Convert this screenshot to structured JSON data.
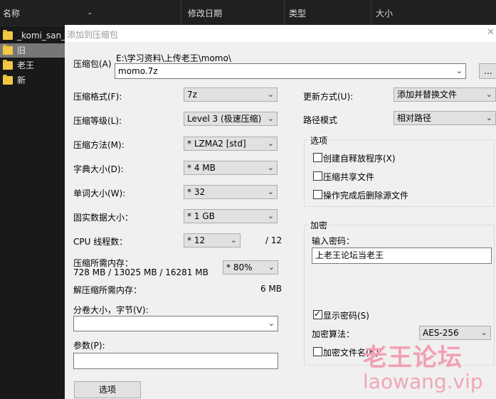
{
  "explorer": {
    "columns": [
      "名称",
      "修改日期",
      "类型",
      "大小"
    ],
    "files": [
      {
        "name": "_komi_san_",
        "selected": false
      },
      {
        "name": "旧",
        "selected": true
      },
      {
        "name": "老王",
        "selected": false
      },
      {
        "name": "新",
        "selected": false
      }
    ]
  },
  "dialog": {
    "title": "添加到压缩包",
    "archive_label": "压缩包(A)",
    "archive_path": "E:\\学习资料\\上传老王\\momo\\",
    "archive_name": "momo.7z",
    "browse_label": "...",
    "format_label": "压缩格式(F):",
    "format_value": "7z",
    "level_label": "压缩等级(L):",
    "level_value": "Level 3 (极速压缩)",
    "method_label": "压缩方法(M):",
    "method_value": "*  LZMA2 [std]",
    "dict_label": "字典大小(D):",
    "dict_value": "*  4 MB",
    "word_label": "单词大小(W):",
    "word_value": "*  32",
    "solid_label": "固实数据大小：",
    "solid_value": "*  1 GB",
    "cpu_label": "CPU 线程数：",
    "cpu_value": "*  12",
    "cpu_total": "/ 12",
    "mem_label": "压缩所需内存：",
    "mem_detail": "728 MB / 13025 MB / 16281 MB",
    "mem_value": "* 80%",
    "decomp_label": "解压缩所需内存：",
    "decomp_value": "6 MB",
    "split_label": "分卷大小，字节(V):",
    "split_value": "",
    "params_label": "参数(P):",
    "params_value": "",
    "options_button": "选项",
    "update_label": "更新方式(U):",
    "update_value": "添加并替换文件",
    "path_label": "路径模式",
    "path_value": "相对路径",
    "options_group": {
      "title": "选项",
      "items": [
        {
          "label": "创建自释放程序(X)",
          "checked": false
        },
        {
          "label": "压缩共享文件",
          "checked": false
        },
        {
          "label": "操作完成后删除源文件",
          "checked": false
        }
      ]
    },
    "encrypt_group": {
      "title": "加密",
      "password_label": "输入密码：",
      "password_value": "上老王论坛当老王",
      "show_password_label": "显示密码(S)",
      "show_password_checked": true,
      "algo_label": "加密算法：",
      "algo_value": "AES-256",
      "encrypt_names_label": "加密文件名(N)",
      "encrypt_names_checked": false
    }
  },
  "watermark": {
    "text": "老王论坛",
    "url": "laowang.vip"
  }
}
